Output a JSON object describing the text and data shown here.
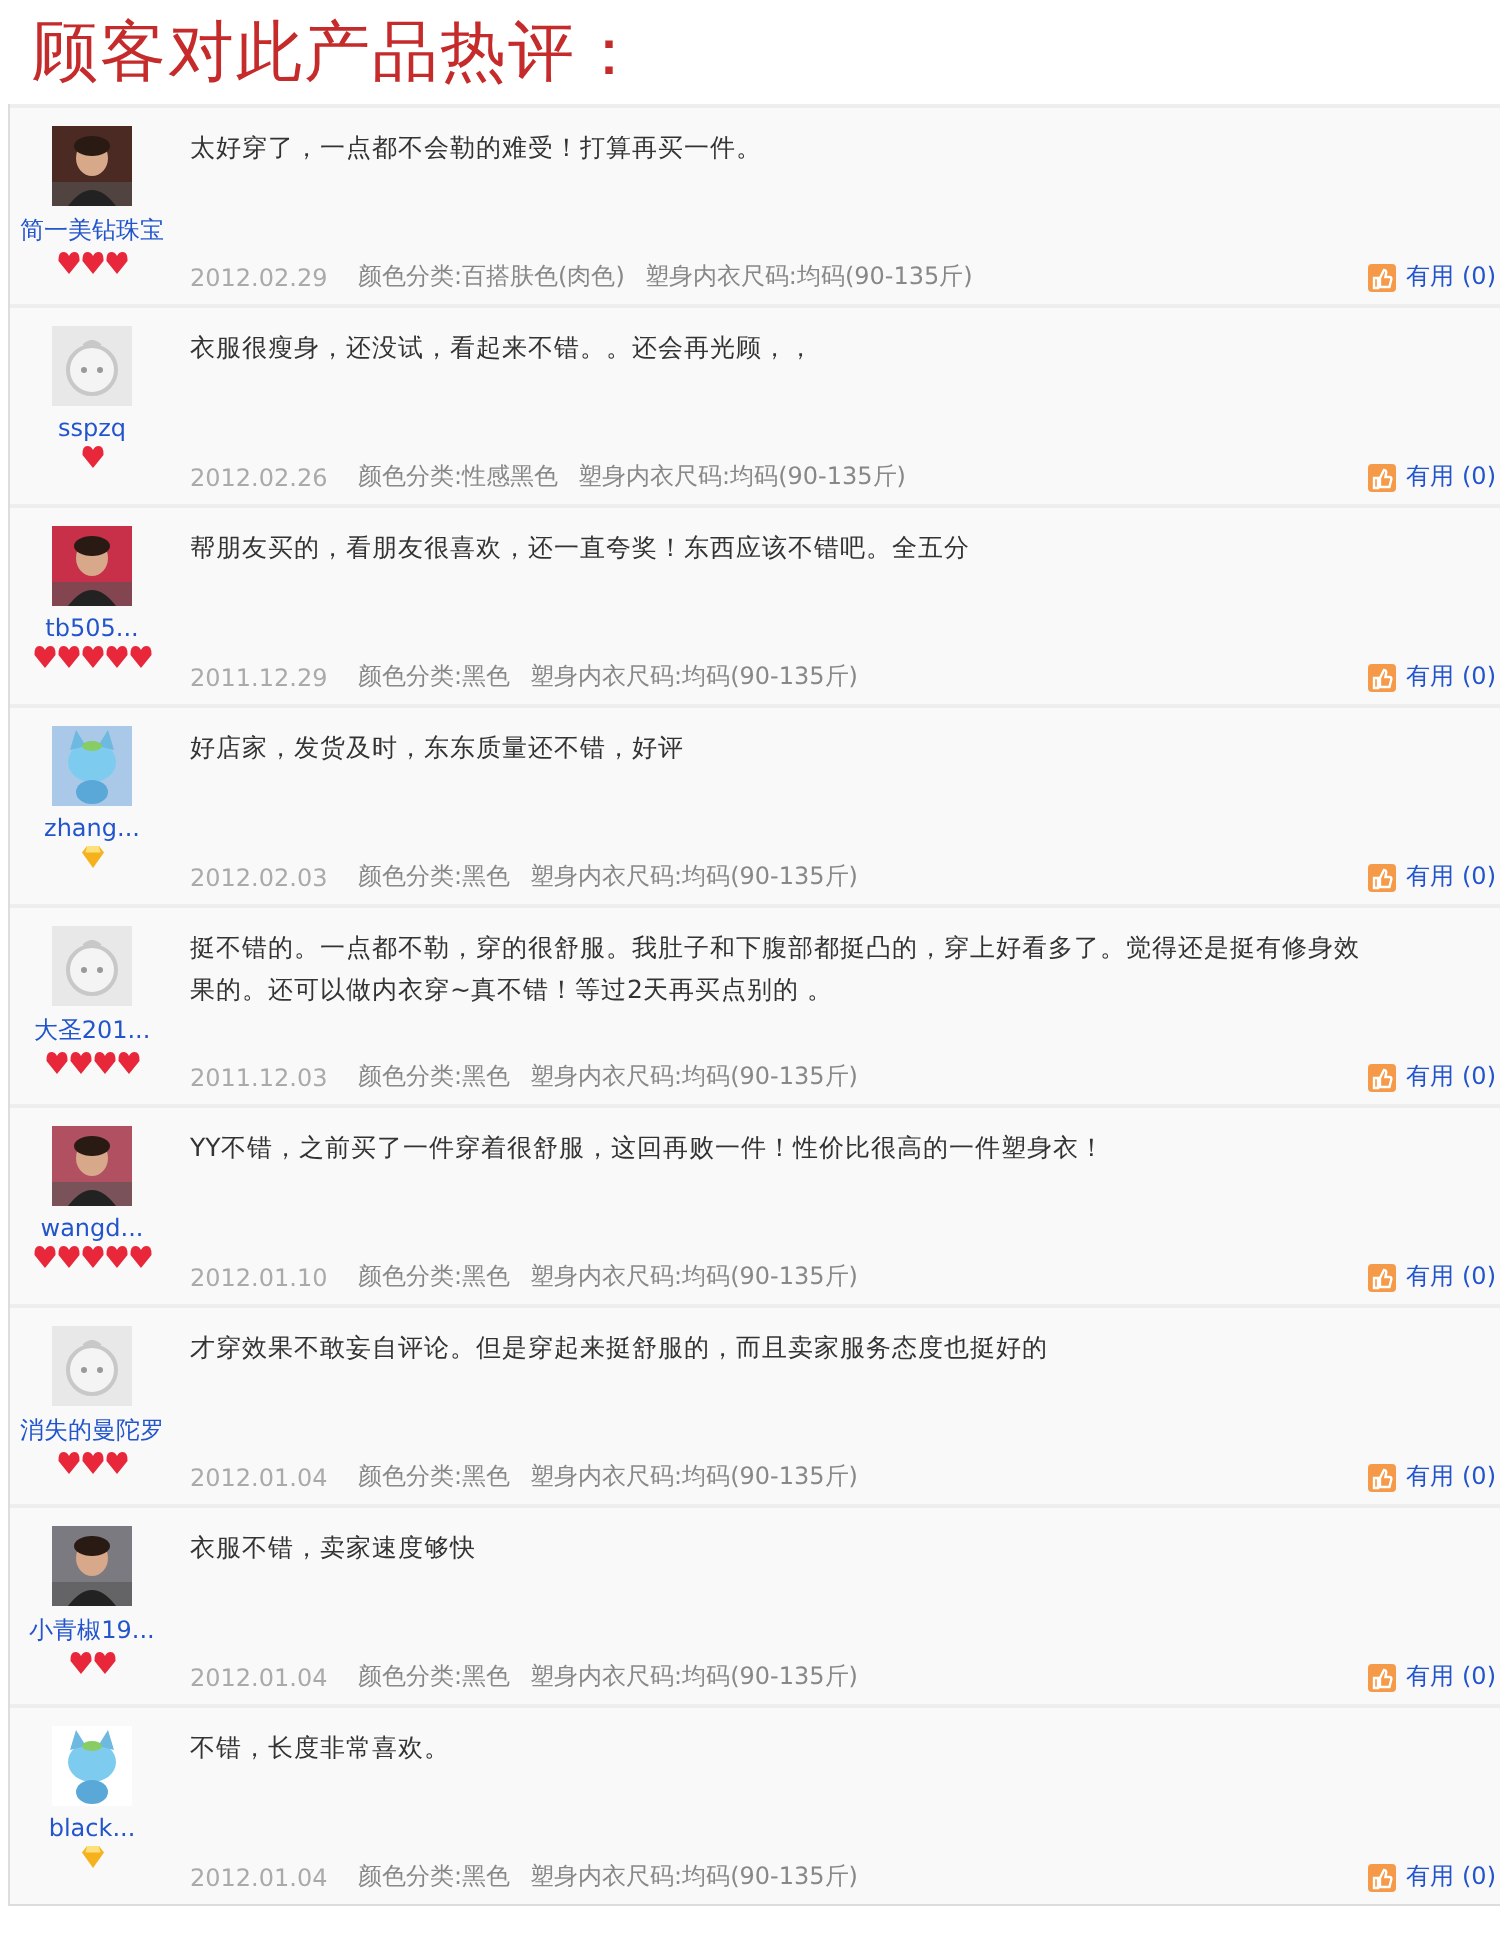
{
  "title": "顾客对此产品热评：",
  "reviews": [
    {
      "user": "简一美钻珠宝",
      "avatar": {
        "kind": "picture"
      },
      "rank": [
        {
          "kind": "heart"
        },
        {
          "kind": "heart"
        },
        {
          "kind": "heart"
        }
      ],
      "text": "太好穿了，一点都不会勒的难受！打算再买一件。",
      "date": "2012.02.29",
      "color_spec": "颜色分类:百搭肤色(肉色)",
      "size_spec": "塑身内衣尺码:均码(90-135斤)",
      "useful": "有用 (0)"
    },
    {
      "user": "sspzq",
      "avatar": {
        "kind": "placeholder"
      },
      "rank": [
        {
          "kind": "heart"
        }
      ],
      "text": "衣服很瘦身，还没试，看起来不错。。还会再光顾，，",
      "date": "2012.02.26",
      "color_spec": "颜色分类:性感黑色",
      "size_spec": "塑身内衣尺码:均码(90-135斤)",
      "useful": "有用 (0)"
    },
    {
      "user": "tb505...",
      "avatar": {
        "kind": "picture"
      },
      "rank": [
        {
          "kind": "heart"
        },
        {
          "kind": "heart"
        },
        {
          "kind": "heart"
        },
        {
          "kind": "heart"
        },
        {
          "kind": "heart"
        }
      ],
      "text": "帮朋友买的，看朋友很喜欢，还一直夸奖！东西应该不错吧。全五分",
      "date": "2011.12.29",
      "color_spec": "颜色分类:黑色",
      "size_spec": "塑身内衣尺码:均码(90-135斤)",
      "useful": "有用 (0)"
    },
    {
      "user": "zhang...",
      "avatar": {
        "kind": "picture"
      },
      "rank": [
        {
          "kind": "diamond"
        }
      ],
      "text": "好店家，发货及时，东东质量还不错，好评",
      "date": "2012.02.03",
      "color_spec": "颜色分类:黑色",
      "size_spec": "塑身内衣尺码:均码(90-135斤)",
      "useful": "有用 (0)"
    },
    {
      "user": "大圣201...",
      "avatar": {
        "kind": "placeholder"
      },
      "rank": [
        {
          "kind": "heart"
        },
        {
          "kind": "heart"
        },
        {
          "kind": "heart"
        },
        {
          "kind": "heart"
        }
      ],
      "text": "挺不错的。一点都不勒，穿的很舒服。我肚子和下腹部都挺凸的，穿上好看多了。觉得还是挺有修身效果的。还可以做内衣穿~真不错！等过2天再买点别的 。",
      "date": "2011.12.03",
      "color_spec": "颜色分类:黑色",
      "size_spec": "塑身内衣尺码:均码(90-135斤)",
      "useful": "有用 (0)"
    },
    {
      "user": "wangd...",
      "avatar": {
        "kind": "picture"
      },
      "rank": [
        {
          "kind": "heart"
        },
        {
          "kind": "heart"
        },
        {
          "kind": "heart"
        },
        {
          "kind": "heart"
        },
        {
          "kind": "heart"
        }
      ],
      "text": "YY不错，之前买了一件穿着很舒服，这回再败一件！性价比很高的一件塑身衣！",
      "date": "2012.01.10",
      "color_spec": "颜色分类:黑色",
      "size_spec": "塑身内衣尺码:均码(90-135斤)",
      "useful": "有用 (0)"
    },
    {
      "user": "消失的曼陀罗",
      "avatar": {
        "kind": "placeholder"
      },
      "rank": [
        {
          "kind": "heart"
        },
        {
          "kind": "heart"
        },
        {
          "kind": "heart"
        }
      ],
      "text": "才穿效果不敢妄自评论。但是穿起来挺舒服的，而且卖家服务态度也挺好的",
      "date": "2012.01.04",
      "color_spec": "颜色分类:黑色",
      "size_spec": "塑身内衣尺码:均码(90-135斤)",
      "useful": "有用 (0)"
    },
    {
      "user": "小青椒19...",
      "avatar": {
        "kind": "picture"
      },
      "rank": [
        {
          "kind": "heart"
        },
        {
          "kind": "heart"
        }
      ],
      "text": "衣服不错，卖家速度够快",
      "date": "2012.01.04",
      "color_spec": "颜色分类:黑色",
      "size_spec": "塑身内衣尺码:均码(90-135斤)",
      "useful": "有用 (0)"
    },
    {
      "user": "black...",
      "avatar": {
        "kind": "picture"
      },
      "rank": [
        {
          "kind": "diamond"
        }
      ],
      "text": "不错，长度非常喜欢。",
      "date": "2012.01.04",
      "color_spec": "颜色分类:黑色",
      "size_spec": "塑身内衣尺码:均码(90-135斤)",
      "useful": "有用 (0)"
    }
  ]
}
